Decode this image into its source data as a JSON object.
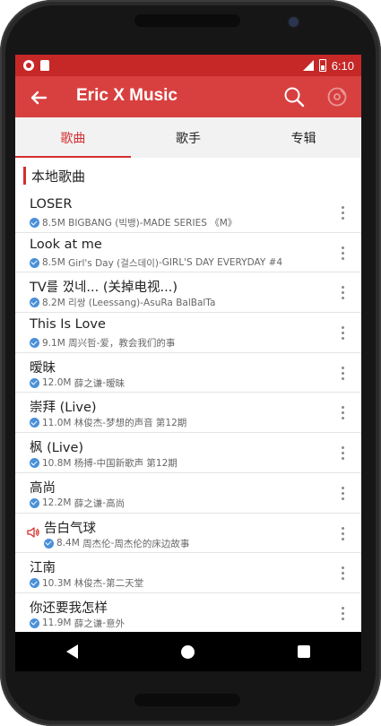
{
  "status_bar": {
    "time": "6:10"
  },
  "toolbar": {
    "title": "Eric X Music"
  },
  "tabs": [
    {
      "label": "歌曲",
      "active": true
    },
    {
      "label": "歌手",
      "active": false
    },
    {
      "label": "专辑",
      "active": false
    }
  ],
  "section": {
    "title": "本地歌曲"
  },
  "songs": [
    {
      "title": "LOSER",
      "size": "8.5M",
      "artist": "BIGBANG (빅뱅)",
      "album": "MADE SERIES 《M》"
    },
    {
      "title": "Look at me",
      "size": "8.5M",
      "artist": "Girl's Day (걸스데이)",
      "album": "GIRL'S DAY EVERYDAY #4"
    },
    {
      "title": "TV를 껐네... (关掉电视...)",
      "size": "8.2M",
      "artist": "리쌍 (Leessang)",
      "album": "AsuRa BalBalTa"
    },
    {
      "title": "This Is Love",
      "size": "9.1M",
      "artist": "周兴哲",
      "album": "爱，教会我们的事"
    },
    {
      "title": "暧昧",
      "size": "12.0M",
      "artist": "薛之谦",
      "album": "暧昧"
    },
    {
      "title": "崇拜 (Live)",
      "size": "11.0M",
      "artist": "林俊杰",
      "album": "梦想的声音 第12期"
    },
    {
      "title": "枫 (Live)",
      "size": "10.8M",
      "artist": "杨搏",
      "album": "中国新歌声 第12期"
    },
    {
      "title": "高尚",
      "size": "12.2M",
      "artist": "薛之谦",
      "album": "高尚"
    },
    {
      "title": "告白气球",
      "size": "8.4M",
      "artist": "周杰伦",
      "album": "周杰伦的床边故事",
      "playing": true
    },
    {
      "title": "江南",
      "size": "10.3M",
      "artist": "林俊杰",
      "album": "第二天堂"
    },
    {
      "title": "你还要我怎样",
      "size": "11.9M",
      "artist": "薛之谦",
      "album": "意外"
    }
  ],
  "meta_separator": " - ",
  "colors": {
    "primary": "#d84040",
    "status_bar": "#c62828",
    "accent": "#d32f2f",
    "verified": "#4a90d9"
  },
  "icons": [
    "back-arrow-icon",
    "search-icon",
    "disc-icon",
    "check-circle-icon",
    "more-vert-icon",
    "speaker-icon"
  ]
}
